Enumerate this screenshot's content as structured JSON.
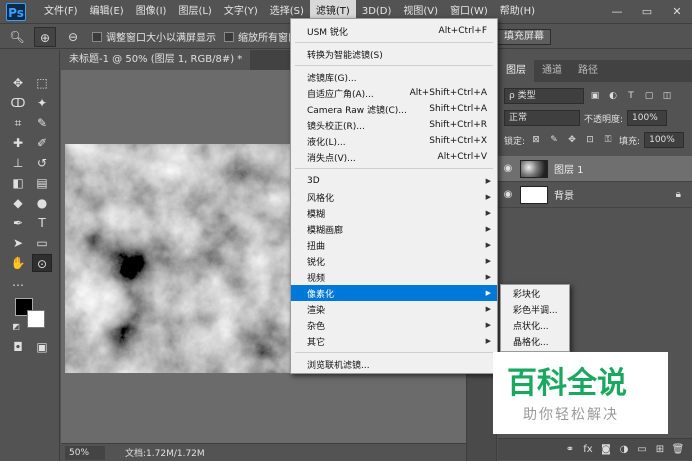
{
  "app": {
    "logo": "Ps"
  },
  "menubar": {
    "items": [
      "文件(F)",
      "编辑(E)",
      "图像(I)",
      "图层(L)",
      "文字(Y)",
      "选择(S)",
      "滤镜(T)",
      "3D(D)",
      "视图(V)",
      "窗口(W)",
      "帮助(H)"
    ],
    "active_index": 6
  },
  "window_controls": {
    "minimize": "—",
    "maximize": "▭",
    "close": "✕"
  },
  "options_bar": {
    "resize_window_label": "调整窗口大小以满屏显示",
    "zoom_all_label": "缩放所有窗口",
    "fill_screen_label": "填充屏幕"
  },
  "document": {
    "tab_title": "未标题-1 @ 50% (图层 1, RGB/8#) *",
    "zoom": "50%",
    "info": "文档:1.72M/1.72M"
  },
  "filter_menu": {
    "groups": [
      [
        {
          "label": "USM 锐化",
          "shortcut": "Alt+Ctrl+F"
        }
      ],
      [
        {
          "label": "转换为智能滤镜(S)",
          "shortcut": ""
        }
      ],
      [
        {
          "label": "滤镜库(G)...",
          "shortcut": ""
        },
        {
          "label": "自适应广角(A)...",
          "shortcut": "Alt+Shift+Ctrl+A"
        },
        {
          "label": "Camera Raw 滤镜(C)...",
          "shortcut": "Shift+Ctrl+A"
        },
        {
          "label": "镜头校正(R)...",
          "shortcut": "Shift+Ctrl+R"
        },
        {
          "label": "液化(L)...",
          "shortcut": "Shift+Ctrl+X"
        },
        {
          "label": "消失点(V)...",
          "shortcut": "Alt+Ctrl+V"
        }
      ],
      [
        {
          "label": "3D",
          "submenu": true
        },
        {
          "label": "风格化",
          "submenu": true
        },
        {
          "label": "模糊",
          "submenu": true
        },
        {
          "label": "模糊画廊",
          "submenu": true
        },
        {
          "label": "扭曲",
          "submenu": true
        },
        {
          "label": "锐化",
          "submenu": true
        },
        {
          "label": "视频",
          "submenu": true
        },
        {
          "label": "像素化",
          "submenu": true,
          "highlighted": true
        },
        {
          "label": "渲染",
          "submenu": true
        },
        {
          "label": "杂色",
          "submenu": true
        },
        {
          "label": "其它",
          "submenu": true
        }
      ],
      [
        {
          "label": "浏览联机滤镜...",
          "shortcut": ""
        }
      ]
    ]
  },
  "pixelate_submenu": [
    "彩块化",
    "彩色半调...",
    "点状化...",
    "晶格化..."
  ],
  "layers_panel": {
    "tabs": [
      "图层",
      "通道",
      "路径"
    ],
    "active_tab": 0,
    "filter_label": "ρ 类型",
    "blend_mode": "正常",
    "opacity_label": "不透明度:",
    "opacity_value": "100%",
    "lock_label": "锁定:",
    "fill_label": "填充:",
    "fill_value": "100%",
    "layers": [
      {
        "name": "图层 1",
        "selected": true
      },
      {
        "name": "背景",
        "selected": false,
        "locked": true
      }
    ]
  },
  "watermark": {
    "title": "百科全说",
    "subtitle": "助你轻松解决"
  },
  "colors": {
    "menu_highlight": "#0078d7",
    "watermark_green": "#1aa861"
  }
}
